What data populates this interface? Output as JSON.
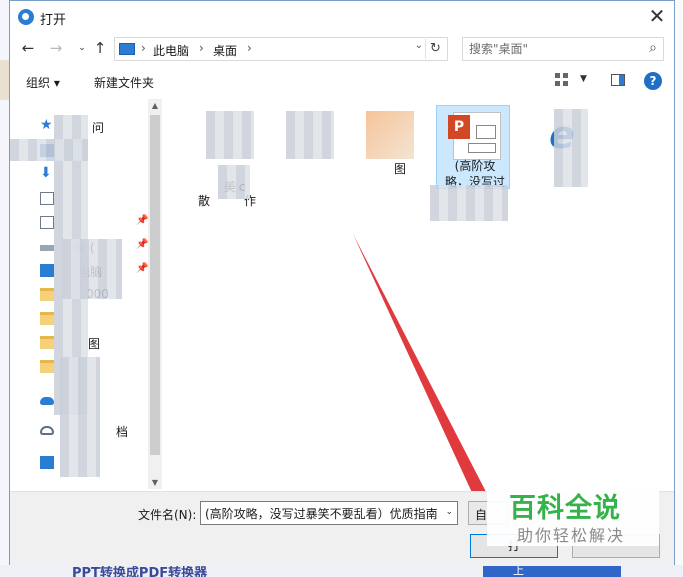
{
  "window": {
    "title": "打开",
    "close_label": "✕"
  },
  "address": {
    "crumbs": [
      "此电脑",
      "桌面"
    ],
    "search_placeholder": "搜索\"桌面\""
  },
  "toolbar": {
    "organize_label": "组织 ▾",
    "new_folder_label": "新建文件夹"
  },
  "nav_pane": {
    "items": [
      {
        "label": "问",
        "icon": "star-icon"
      },
      {
        "label": "",
        "icon": "desktop-icon"
      },
      {
        "label": "",
        "icon": "download-icon"
      },
      {
        "label": "",
        "icon": "document-icon"
      },
      {
        "label": "",
        "icon": "picture-icon"
      },
      {
        "label": "卷 (",
        "icon": "drive-icon"
      },
      {
        "label": "电脑",
        "icon": "computer-icon"
      },
      {
        "label": "000",
        "icon": "folder-icon"
      },
      {
        "label": "",
        "icon": "folder-icon"
      },
      {
        "label": "图",
        "icon": "folder-icon"
      },
      {
        "label": "",
        "icon": "folder-icon"
      },
      {
        "label": "",
        "icon": "onedrive-icon"
      },
      {
        "label": "档",
        "icon": "cloud-icon"
      },
      {
        "label": "",
        "icon": "computer-icon"
      }
    ]
  },
  "files": [
    {
      "name": "美",
      "name2": "散",
      "name3": "c",
      "name4": "作",
      "thumb": "blurred-image-icon"
    },
    {
      "name": "",
      "thumb": "blurred-image-icon"
    },
    {
      "name": "图",
      "thumb": "image-file-icon"
    },
    {
      "name": "(高阶攻",
      "name2": "略，没写过",
      "thumb": "powerpoint-file-icon",
      "selected": true
    },
    {
      "name": "",
      "thumb": "ie-shortcut-icon"
    }
  ],
  "footer": {
    "filename_label": "文件名(N):",
    "filename_value": "(高阶攻略，没写过暴笑不要乱看）优质指南",
    "filetype_label": "自",
    "open_label": "打"
  },
  "watermark": {
    "line1": "百科全说",
    "line2": "助你轻松解决"
  },
  "background": {
    "bottom_text": "PPT转换成PDF转换器",
    "bottom_button": "上"
  },
  "colors": {
    "accent": "#2b7cd3",
    "selection": "#cce8ff",
    "arrow": "#e0393e",
    "watermark_green": "#35b34a"
  }
}
